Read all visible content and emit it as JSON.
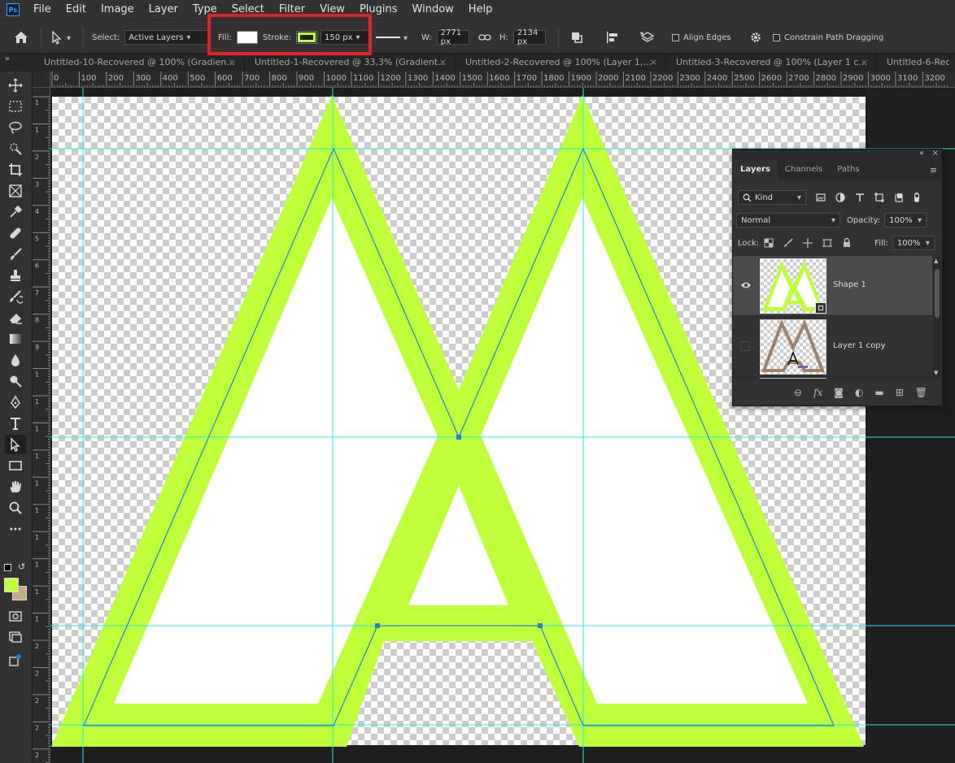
{
  "app": {
    "logo_text": "Ps"
  },
  "menu": [
    "File",
    "Edit",
    "Image",
    "Layer",
    "Type",
    "Select",
    "Filter",
    "View",
    "Plugins",
    "Window",
    "Help"
  ],
  "options": {
    "select_label": "Select:",
    "select_value": "Active Layers",
    "fill_label": "Fill:",
    "fill_color": "#ffffff",
    "stroke_label": "Stroke:",
    "stroke_color": "#bfff3a",
    "stroke_width": "150 px",
    "w_label": "W:",
    "w_value": "2771 px",
    "h_label": "H:",
    "h_value": "2134 px",
    "align_edges": "Align Edges",
    "constrain": "Constrain Path Dragging"
  },
  "tabs": [
    "Untitled-10-Recovered @ 100% (Gradien...",
    "Untitled-1-Recovered @ 33,3% (Gradient...",
    "Untitled-2-Recovered @ 100% (Layer 1,...",
    "Untitled-3-Recovered @ 100% (Layer 1 c...",
    "Untitled-6-Reco"
  ],
  "tabs_collapse": "»",
  "ruler": {
    "h_labels": [
      "0",
      "100",
      "200",
      "300",
      "400",
      "500",
      "600",
      "700",
      "800",
      "900",
      "1000",
      "1100",
      "1200",
      "1300",
      "1400",
      "1500",
      "1600",
      "1700",
      "1800",
      "1900",
      "2000",
      "2100",
      "2200",
      "2300",
      "2400",
      "2500",
      "2600",
      "2700",
      "2800",
      "2900",
      "3000",
      "3100",
      "3200"
    ],
    "v_labels": [
      "1",
      "1",
      "2",
      "3",
      "4",
      "5",
      "6",
      "7",
      "8",
      "9",
      "1",
      "1",
      "1",
      "1",
      "1",
      "1",
      "1",
      "1",
      "1",
      "1",
      "2",
      "2",
      "2",
      "2",
      "2",
      "2"
    ]
  },
  "colors": {
    "foreground": "#bfff3a",
    "background": "#c8a98a",
    "guide": "#25e8e8",
    "path": "#1e7fd8",
    "highlight": "#e0232a"
  },
  "layers_panel": {
    "tabs": [
      "Layers",
      "Channels",
      "Paths"
    ],
    "kind": "Kind",
    "blend_mode": "Normal",
    "opacity_label": "Opacity:",
    "opacity_value": "100%",
    "lock_label": "Lock:",
    "fill_label": "Fill:",
    "fill_value": "100%",
    "layers": [
      {
        "name": "Shape 1",
        "visible": true,
        "selected": true
      },
      {
        "name": "Layer 1 copy",
        "visible": false,
        "selected": false
      }
    ]
  }
}
